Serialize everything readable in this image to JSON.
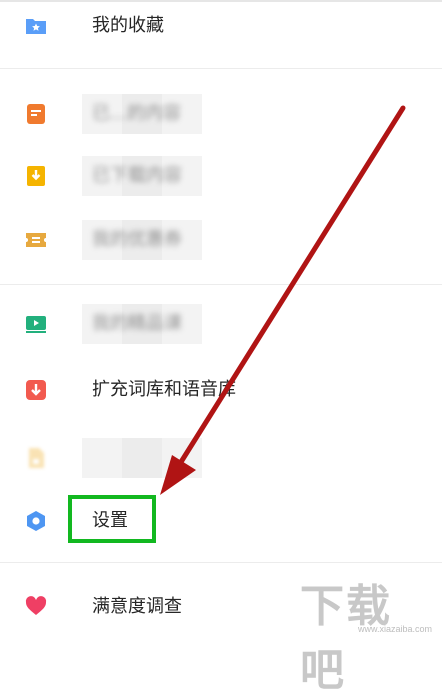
{
  "menu": {
    "favorites": {
      "label": "我的收藏",
      "icon": "folder-star-icon",
      "color": "#5a9ef8"
    },
    "blurred_1": {
      "label": "已...的内容",
      "icon": "receipt-icon",
      "color": "#f07a2e"
    },
    "blurred_2": {
      "label": "已下载内容",
      "icon": "download-bookmark-icon",
      "color": "#f5b400"
    },
    "coupons": {
      "label": "我的优惠券",
      "icon": "ticket-icon",
      "color": "#e7a93f"
    },
    "blurred_3": {
      "label": "我的精品课",
      "icon": "video-play-icon",
      "color": "#22b07d"
    },
    "dictionary": {
      "label": "扩充词库和语音库",
      "icon": "download-box-icon",
      "color": "#f25a4f"
    },
    "blurred_4": {
      "label": "",
      "icon": "document-icon",
      "color": "#f2c15a"
    },
    "settings": {
      "label": "设置",
      "icon": "hexagon-settings-icon",
      "color": "#4e96f2"
    },
    "survey": {
      "label": "满意度调查",
      "icon": "heart-icon",
      "color": "#ef3f64"
    }
  },
  "annotation": {
    "arrow_color": "#b01414",
    "highlight_color": "#12b820"
  },
  "watermark": {
    "big": "下载吧",
    "small": "www.xiazaiba.com"
  }
}
